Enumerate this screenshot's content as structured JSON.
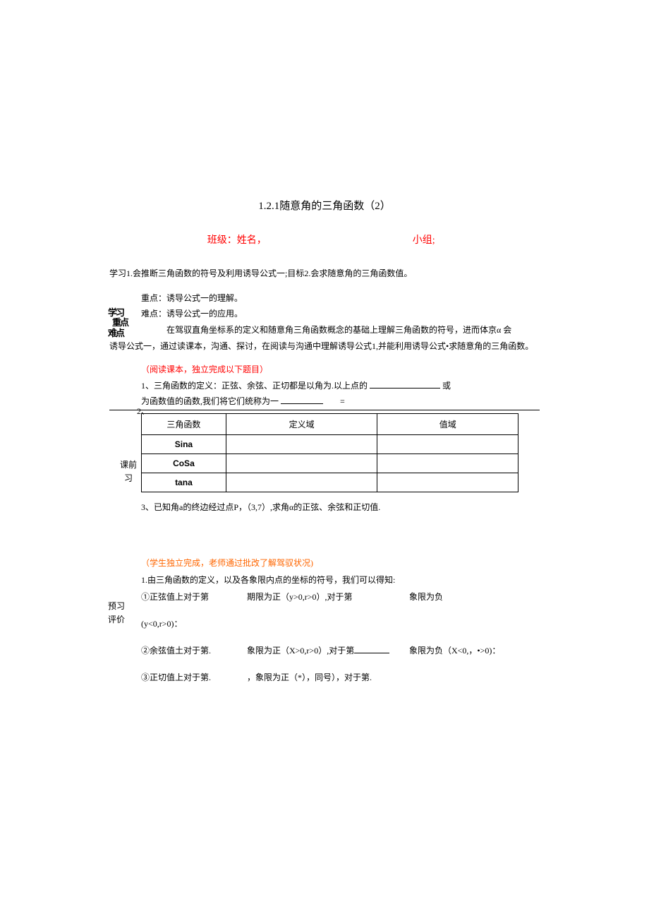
{
  "title": "1.2.1随意角的三角函数（2）",
  "subtitle": {
    "part1": "班级：姓名，",
    "part2": "小组;"
  },
  "learning_goal": "学习1.会推断三角函数的符号及利用诱导公式一;目标2.会求随意角的三角函数值。",
  "side_label_focus": "学习重点难点",
  "focus": {
    "line1": "重点：诱导公式一的理解。",
    "line2": "难点：诱导公式一的应用。",
    "line3": "　　　在驾驭直角坐标系的定义和随意角三角函数概念的基础上理解三角函数的符号，进而体京α 会"
  },
  "focus_line4": "诱导公式一，通过读课本，沟通、探讨，在阅读与沟通中理解诱导公式1,并能利用诱导公式•求随意角的三角函数。",
  "prestudy_header": "（阅读课本，独立完成以下题目）",
  "prestudy_q1a": "1、三角函数的定义：正弦、余弦、正切都是以角为.以上点的",
  "prestudy_q1b": "或",
  "prestudy_q1c": "为函数值的函数,我们将它们统称为一",
  "side_label_pre": {
    "a": "课前",
    "b": "习"
  },
  "table": {
    "h1": "三角函数",
    "h2": "定义域",
    "h3": "值域",
    "r1": "Sina",
    "r2": "CoSa",
    "r3": "tana"
  },
  "num2": "2、",
  "q3": "3、已知角a的终边经过点P，（3,7）,求角α的正弦、余弦和正切值.",
  "eval_header": "（学生独立完成，老师通过批改了解驾驭状况)",
  "eval_q1": "1.由三角函数的定义，以及各象限内点的坐标的符号，我们可以得知:",
  "eval_sin1": "①正弦值上对于第",
  "eval_sin2": "期限为正（y>0,r>0）,对于第",
  "eval_sin3": "象限为负",
  "eval_sin4": "(y<0,r>0)：",
  "eval_cos1": "②余弦值土对于第.",
  "eval_cos2": "象限为正（X>0,r>0）,对于第",
  "eval_cos3": "象限为负（X<0,，•>0)：",
  "eval_tan1": "③正切值上对于第.",
  "eval_tan2": "，象限为正（*），同号），对于第.",
  "side_label_eval": {
    "a": "预习",
    "b": "评价"
  }
}
